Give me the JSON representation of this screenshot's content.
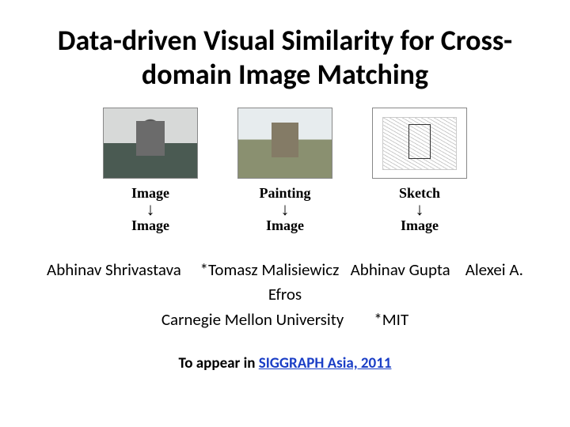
{
  "title": "Data-driven Visual Similarity for Cross-domain Image Matching",
  "pairs": [
    {
      "top": "Image",
      "bottom": "Image"
    },
    {
      "top": "Painting",
      "bottom": "Image"
    },
    {
      "top": "Sketch",
      "bottom": "Image"
    }
  ],
  "authors_line": "Abhinav Shrivastava     *Tomasz Malisiewicz   Abhinav Gupta    Alexei A. Efros",
  "affil_line": "Carnegie Mellon University        *MIT",
  "venue_prefix": "To appear in ",
  "venue_link": "SIGGRAPH Asia, 2011"
}
